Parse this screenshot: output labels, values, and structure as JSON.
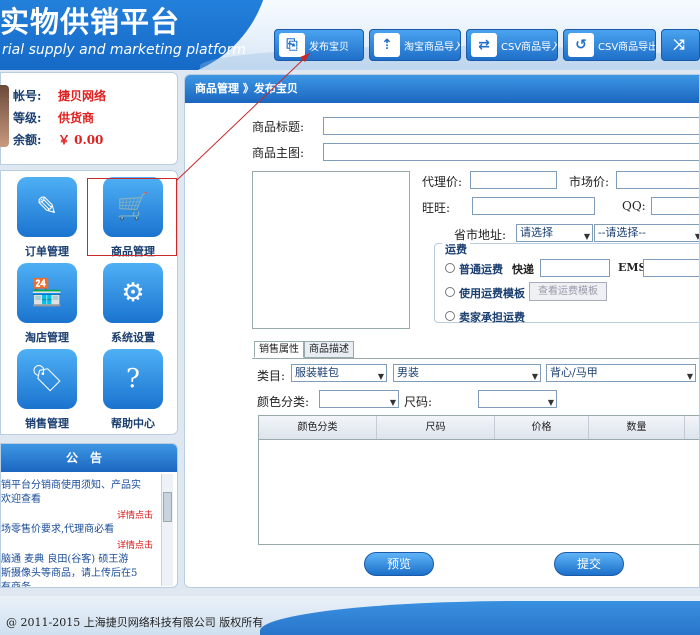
{
  "header": {
    "title": "实物供销平台",
    "subtitle": "rial supply and marketing platform",
    "toolbar": [
      {
        "label": "发布宝贝",
        "icon": "publish-icon"
      },
      {
        "label": "淘宝商品导入",
        "icon": "import-icon"
      },
      {
        "label": "CSV商品导入",
        "icon": "csv-import-icon"
      },
      {
        "label": "CSV商品导出",
        "icon": "csv-export-icon"
      },
      {
        "label": "",
        "icon": "shuffle-icon"
      }
    ]
  },
  "user": {
    "account_label": "帐号:",
    "account_value": "捷贝网络",
    "level_label": "等级:",
    "level_value": "供货商",
    "balance_label": "余额:",
    "balance_value": "￥ 0.00"
  },
  "nav": [
    {
      "label": "订单管理",
      "icon": "order-icon"
    },
    {
      "label": "商品管理",
      "icon": "cart-icon"
    },
    {
      "label": "淘店管理",
      "icon": "shop-icon"
    },
    {
      "label": "系统设置",
      "icon": "gear-icon"
    },
    {
      "label": "销售管理",
      "icon": "sale-tag-icon"
    },
    {
      "label": "帮助中心",
      "icon": "help-icon"
    }
  ],
  "notice": {
    "title": "公告",
    "lines": [
      "销平台分销商使用须知、产品实",
      "欢迎查看",
      "场零售价要求,代理商必看",
      "脑通 麦典 良田(谷客) 硕王游",
      "斯摄像头等商品，请上传后在5",
      "有商务..."
    ],
    "more": "详情点击"
  },
  "main": {
    "breadcrumb": "商品管理 》发布宝贝",
    "title_label": "商品标题:",
    "image_label": "商品主图:",
    "agent_price_label": "代理价:",
    "market_price_label": "市场价:",
    "wangwang_label": "旺旺:",
    "qq_label": "QQ:",
    "address_label": "省市地址:",
    "province_select": "请选择",
    "city_select": "--请选择--",
    "shipping": {
      "legend": "运费",
      "normal_label": "普通运费",
      "express_label": "快递",
      "ems_label": "EMS",
      "template_label": "使用运费模板",
      "template_button": "查看运费模板",
      "seller_label": "卖家承担运费"
    },
    "tabs": [
      "销售属性",
      "商品描述"
    ],
    "category_label": "类目:",
    "category": [
      "服装鞋包",
      "男装",
      "背心/马甲"
    ],
    "color_label": "颜色分类:",
    "size_label": "尺码:",
    "grid_headers": [
      "颜色分类",
      "尺码",
      "价格",
      "数量"
    ],
    "preview_button": "预览",
    "submit_button": "提交"
  },
  "footer": {
    "copyright": "@ 2011-2015 上海捷贝网络科技有限公司 版权所有"
  },
  "colors": {
    "accent": "#1b6fc9",
    "label_red": "#e02020"
  }
}
